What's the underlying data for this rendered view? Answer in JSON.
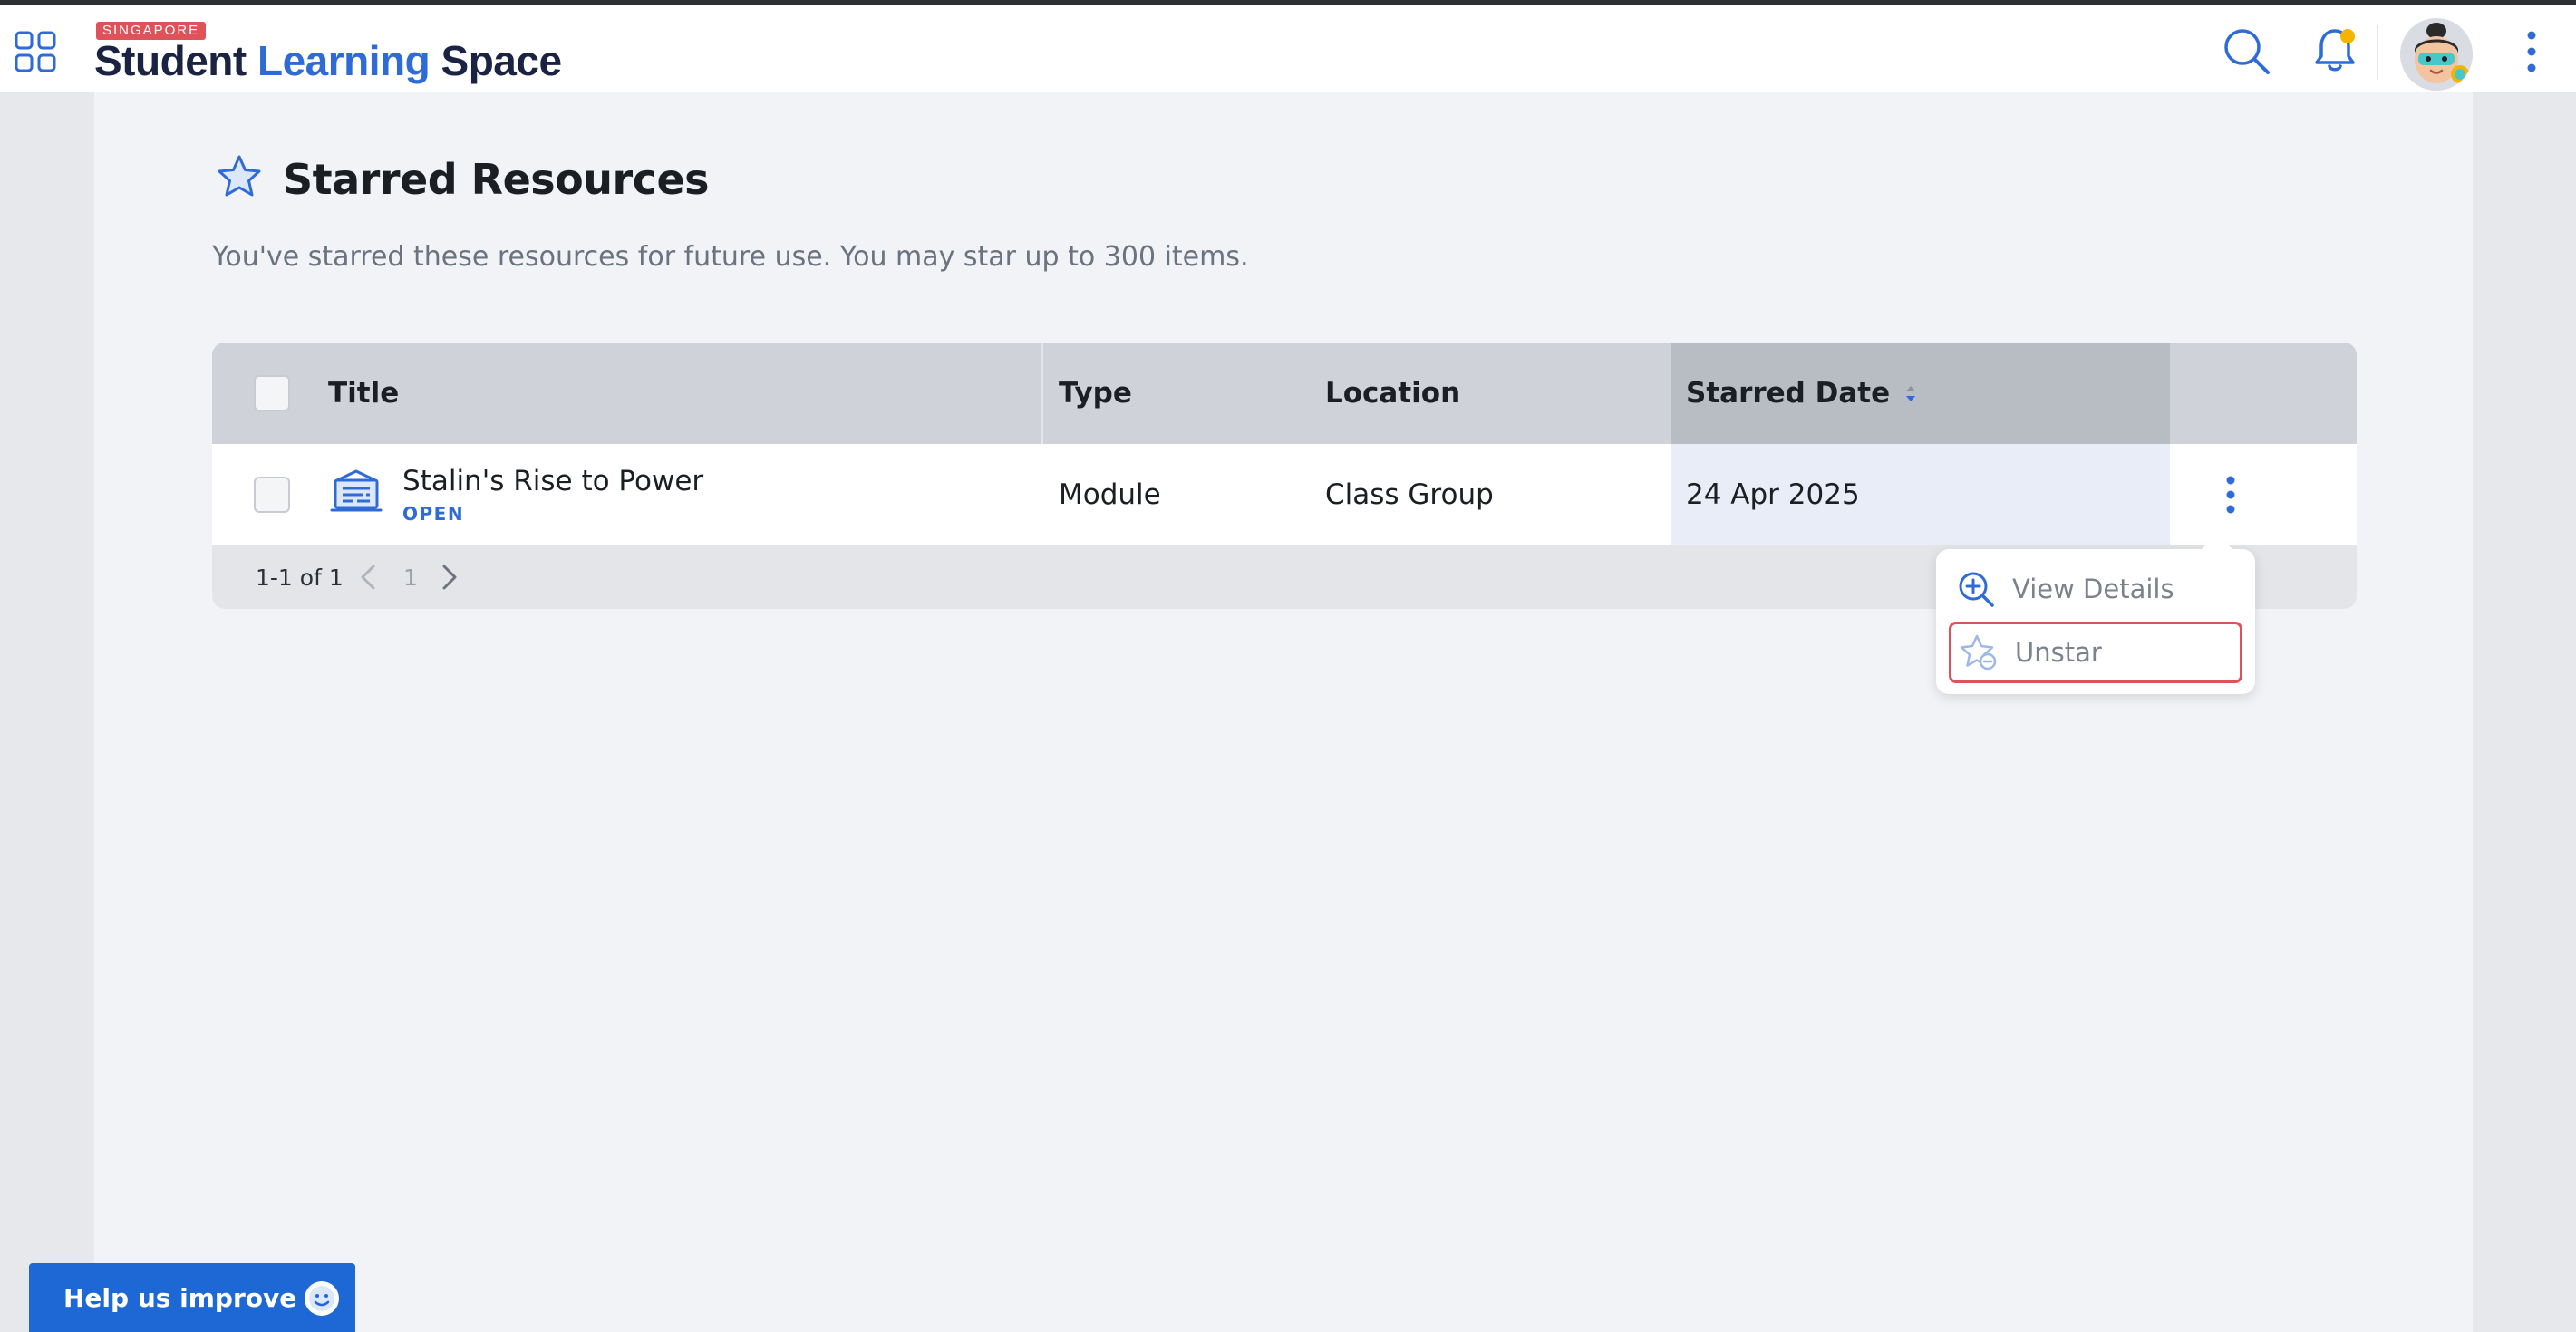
{
  "header": {
    "logo_tag": "SINGAPORE",
    "logo_word1": "Student",
    "logo_word2": "Learning",
    "logo_word3": "Space",
    "icons": [
      "apps-grid-icon",
      "search-icon",
      "bell-icon",
      "avatar",
      "more-vertical-icon"
    ],
    "notification_dot_color": "#f5b400"
  },
  "page": {
    "title": "Starred Resources",
    "subtitle": "You've starred these resources for future use. You may star up to 300 items."
  },
  "table": {
    "columns": {
      "title": "Title",
      "type": "Type",
      "location": "Location",
      "starred_date": "Starred Date"
    },
    "sorted_column": "starred_date",
    "rows": [
      {
        "title": "Stalin's Rise to Power",
        "status": "OPEN",
        "type": "Module",
        "location": "Class Group",
        "starred_date": "24 Apr 2025",
        "icon": "module-icon"
      }
    ]
  },
  "pagination": {
    "range_text": "1-1 of 1",
    "current_page": "1"
  },
  "row_menu": {
    "view_details": "View Details",
    "unstar": "Unstar",
    "highlighted_item": "unstar"
  },
  "help": {
    "label": "Help us improve"
  },
  "colors": {
    "brand_blue": "#2f6bd6",
    "brand_navy": "#1a2342",
    "accent_red": "#e0525a",
    "help_button": "#1e68d6"
  }
}
